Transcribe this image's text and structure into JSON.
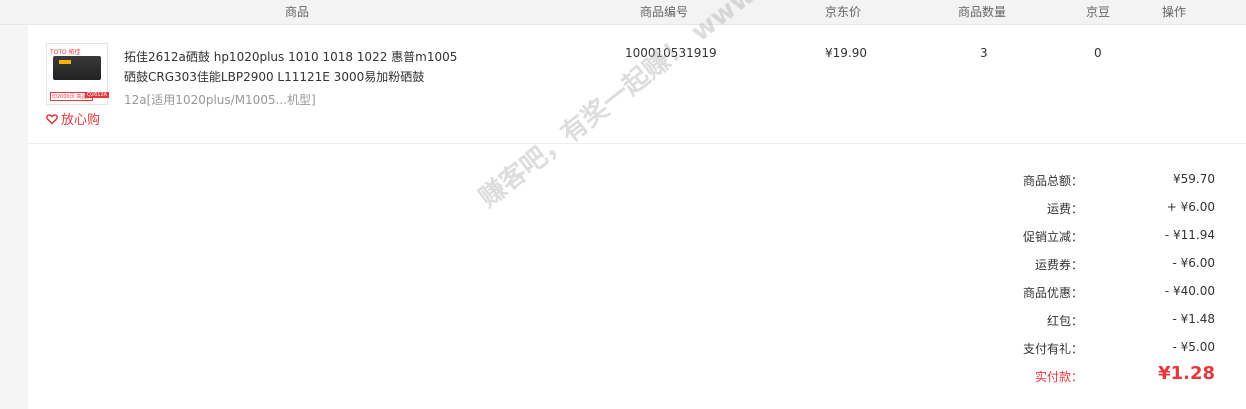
{
  "columns": {
    "product": "商品",
    "sku": "商品编号",
    "price": "京东价",
    "quantity": "商品数量",
    "jingdou": "京豆",
    "action": "操作"
  },
  "item": {
    "title": "拓佳2612a硒鼓 hp1020plus 1010 1018 1022 惠普m1005硒鼓CRG303佳能LBP2900 L11121E 3000易加粉硒鼓",
    "spec": "12a[适用1020plus/M1005...机型]",
    "sku": "100010531919",
    "price": "¥19.90",
    "quantity": "3",
    "jingdou": "0",
    "badge": "放心购",
    "thumb_brand": "TOTO 拓佳",
    "thumb_tag1": "印2000页 高品质",
    "thumb_tag2": "Q2612A"
  },
  "summary": [
    {
      "label": "商品总额：",
      "value": "¥59.70"
    },
    {
      "label": "运费：",
      "value": "+ ¥6.00"
    },
    {
      "label": "促销立减：",
      "value": "- ¥11.94"
    },
    {
      "label": "运费券：",
      "value": "- ¥6.00"
    },
    {
      "label": "商品优惠：",
      "value": "- ¥40.00"
    },
    {
      "label": "红包：",
      "value": "- ¥1.48"
    },
    {
      "label": "支付有礼：",
      "value": "- ¥5.00"
    },
    {
      "label": "实付款：",
      "value": "¥1.28"
    }
  ],
  "watermark": "赚客吧，有奖一起赚！ www.zuanke8.com",
  "colors": {
    "accent": "#e4393c"
  }
}
